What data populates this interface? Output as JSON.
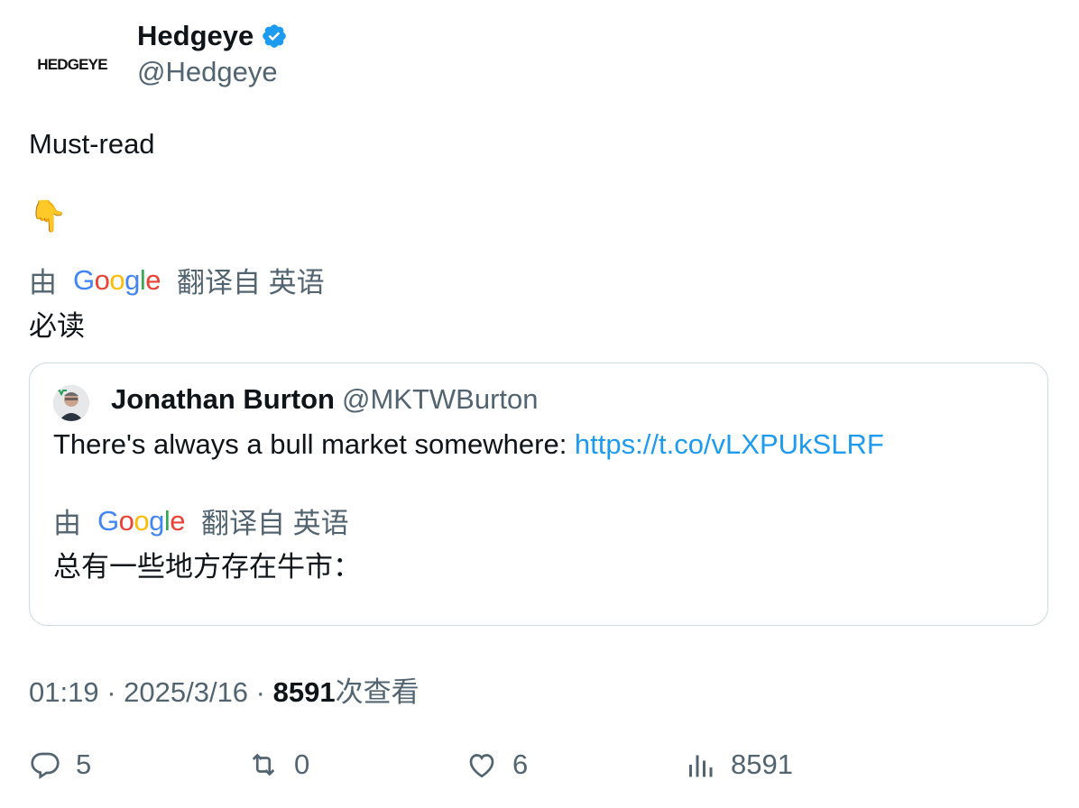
{
  "author": {
    "logo_text": "HEDGEYE",
    "name": "Hedgeye",
    "handle": "@Hedgeye",
    "verified_icon": "verified-badge-icon"
  },
  "tweet": {
    "text": "Must-read",
    "emoji": "👇",
    "translate": {
      "prefix": "由",
      "brand": "Google",
      "suffix": "翻译自 英语"
    },
    "translated_text": "必读"
  },
  "quote": {
    "name": "Jonathan Burton",
    "handle": "@MKTWBurton",
    "text": "There's always a bull market somewhere: ",
    "link": "https://t.co/vLXPUkSLRF",
    "translate": {
      "prefix": "由",
      "brand": "Google",
      "suffix": "翻译自 英语"
    },
    "translated_text": "总有一些地方存在牛市："
  },
  "meta": {
    "time": "01:19",
    "sep": " · ",
    "date": "2025/3/16",
    "views_count": "8591",
    "views_label": "次查看"
  },
  "actions": {
    "replies": "5",
    "retweets": "0",
    "likes": "6",
    "views": "8591"
  },
  "colors": {
    "link": "#1d9bf0",
    "muted": "#536471",
    "verified": "#1d9bf0"
  }
}
